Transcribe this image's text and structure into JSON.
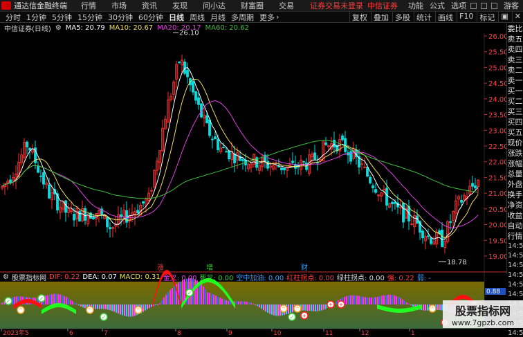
{
  "titlebar": {
    "app_name": "通达信金融终端",
    "menus": [
      "行情",
      "市场",
      "资讯",
      "发现",
      "问小达",
      "财富圈",
      "交易"
    ],
    "warning": "证券交易未登录",
    "broker": "中信证券",
    "right_items": [
      "功能",
      "公式",
      "选项"
    ],
    "guest": "游客"
  },
  "toolbar": {
    "periods": [
      "分时",
      "1分钟",
      "5分钟",
      "15分钟",
      "30分钟",
      "60分钟",
      "日线",
      "周线",
      "月线",
      "多周期",
      "更多"
    ],
    "active_period": "日线",
    "tools": [
      "叠加",
      "画线",
      "F10",
      "标记"
    ],
    "tools_pre": [
      "复权",
      "叠加",
      "多股",
      "统计"
    ]
  },
  "chart": {
    "stock_name": "中信证券(日线)",
    "ma5_label": "MA5: 20.79",
    "ma10_label": "MA10: 20.67",
    "ma20_label": "MA20: 20.17",
    "ma60_label": "MA60: 20.62",
    "high_marker": "26.10",
    "low_marker": "18.78",
    "price_ticks": [
      "26.00",
      "25.50",
      "25.00",
      "24.50",
      "24.00",
      "23.50",
      "23.00",
      "22.50",
      "22.00",
      "21.50",
      "21.00",
      "20.50",
      "20.00",
      "19.50",
      "19.00"
    ],
    "event_labels": [
      {
        "text": "涨",
        "color": "#ff3b3b"
      },
      {
        "text": "增",
        "color": "#3ad03a"
      },
      {
        "text": "财",
        "color": "#3aa0ff"
      }
    ],
    "colors": {
      "ma5": "#ffffff",
      "ma10": "#f0e060",
      "ma20": "#e040e0",
      "ma60": "#40c040",
      "up": "#ff3030",
      "down": "#00e0e0"
    }
  },
  "indicator": {
    "name": "股票指标网",
    "dif": "DIF: 0.22",
    "dea": "DEA: 0.07",
    "macd": "MACD: 0.31",
    "jincha": "金叉: 0.00",
    "sicha": "死叉: 0.00",
    "kongzhong": "空中加油: 0.00",
    "hongzhu": "红柱拐点: 0.00",
    "lvzhu": "绿柱拐点: 0.00",
    "qiang": "强: 0.22",
    "ruo": "弱: -",
    "ticks": [
      "0.88",
      "0.00"
    ]
  },
  "xaxis": {
    "labels": [
      "2023年5",
      "6",
      "7",
      "8",
      "9",
      "10",
      "11",
      "12",
      "1"
    ]
  },
  "side_panel": {
    "top": "委比",
    "labels": [
      {
        "t": "卖五",
        "c": "white"
      },
      {
        "t": "卖四",
        "c": "white"
      },
      {
        "t": "卖三",
        "c": "white"
      },
      {
        "t": "卖二",
        "c": "white"
      },
      {
        "t": "卖一",
        "c": "white"
      },
      {
        "t": "买一",
        "c": "white"
      },
      {
        "t": "买二",
        "c": "white"
      },
      {
        "t": "买三",
        "c": "white"
      },
      {
        "t": "买四",
        "c": "white"
      },
      {
        "t": "买五",
        "c": "white"
      },
      {
        "t": "现价",
        "c": "white"
      },
      {
        "t": "涨跌",
        "c": "white"
      },
      {
        "t": "涨幅",
        "c": "white"
      },
      {
        "t": "总量",
        "c": "white"
      },
      {
        "t": "外盘",
        "c": "white"
      },
      {
        "t": "换手",
        "c": "white"
      },
      {
        "t": "净资",
        "c": "white"
      },
      {
        "t": "收益",
        "c": "white"
      },
      {
        "t": "自动",
        "c": "white"
      },
      {
        "t": "行情",
        "c": "white"
      }
    ],
    "times": [
      "14:5",
      "14:5",
      "14:5",
      "14:5",
      "14:5",
      "14:5",
      "14:5",
      "14:5",
      "14:5",
      "14:5"
    ]
  },
  "watermark": {
    "line1": "股票指标网",
    "line2": "www.7gpzb.com"
  }
}
